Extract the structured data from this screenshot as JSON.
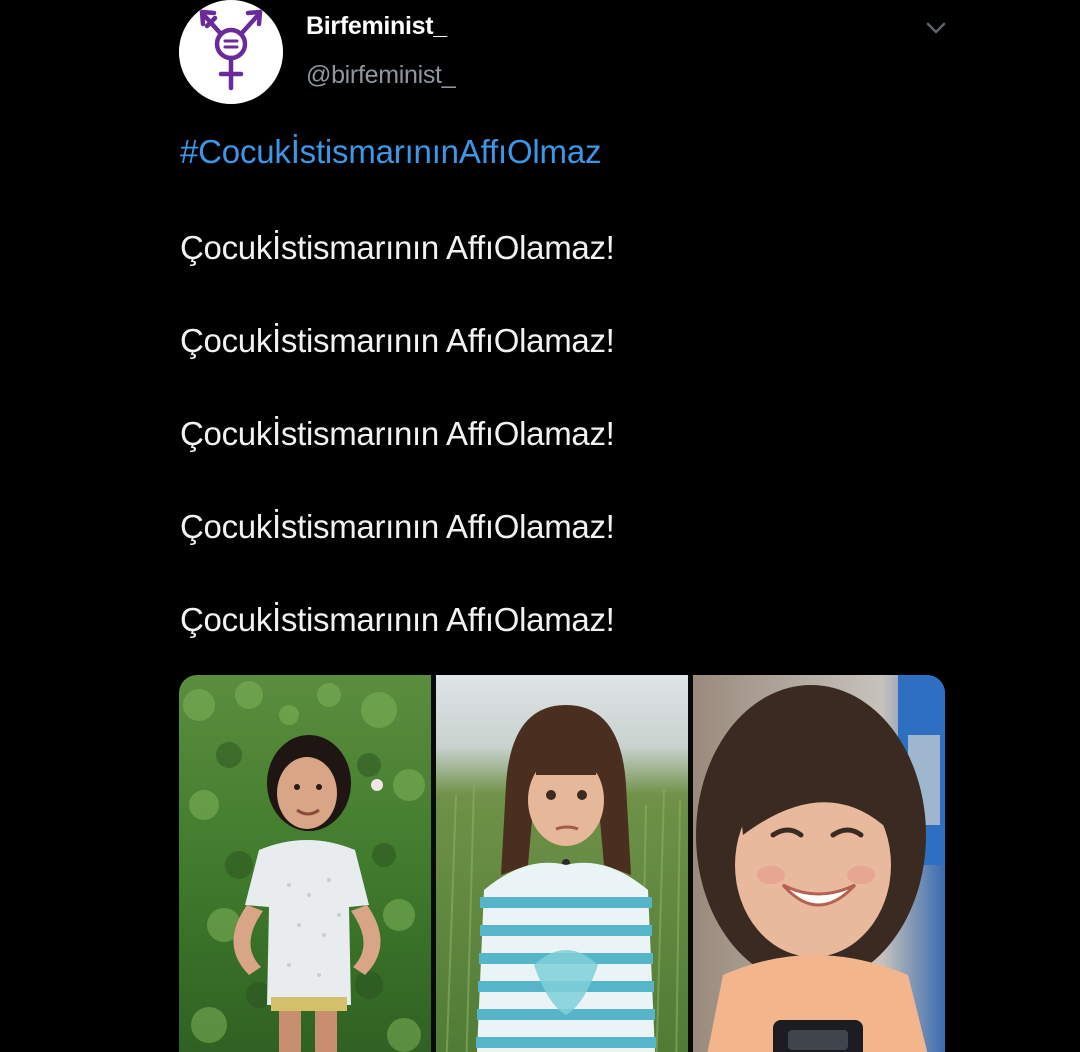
{
  "tweet": {
    "display_name": "Birfeminist_",
    "handle": "@birfeminist_",
    "hashtag": "#CocukİstismarınınAffıOlmaz",
    "lines": [
      "Çocukİstismarının AffıOlamaz!",
      "Çocukİstismarının AffıOlamaz!",
      "Çocukİstismarının AffıOlamaz!",
      "Çocukİstismarının AffıOlamaz!",
      "Çocukİstismarının AffıOlamaz!"
    ]
  },
  "icons": {
    "avatar": "transgender-symbol-icon",
    "menu": "chevron-down-icon"
  },
  "colors": {
    "background": "#000000",
    "hashtag": "#3d97e8",
    "handle": "#8f979e",
    "avatar_symbol": "#6a2a9a"
  }
}
